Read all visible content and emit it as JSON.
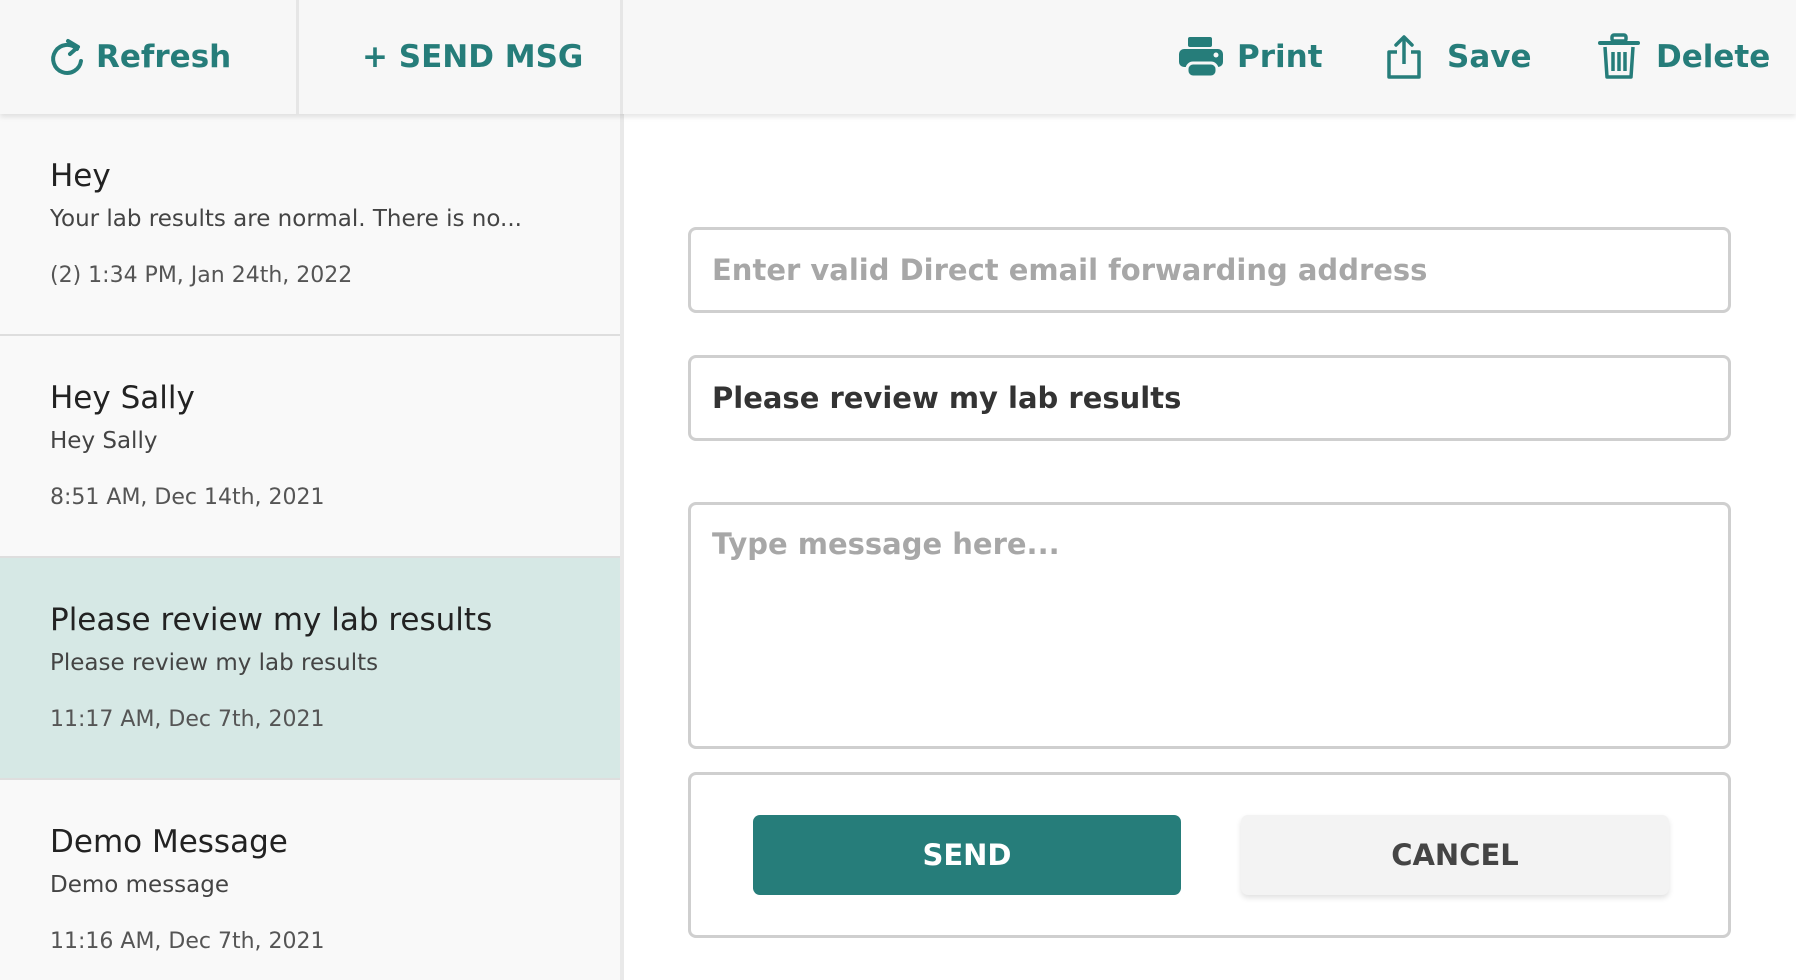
{
  "colors": {
    "accent": "#267d7a",
    "selected_row": "#d6e8e5",
    "toolbar_bg": "#f7f7f7"
  },
  "toolbar": {
    "refresh": {
      "label": "Refresh",
      "icon": "refresh-icon"
    },
    "send_msg": {
      "label": "+ SEND MSG"
    },
    "print": {
      "label": "Print",
      "icon": "printer-icon"
    },
    "save": {
      "label": "Save",
      "icon": "share-upload-icon"
    },
    "delete": {
      "label": "Delete",
      "icon": "trash-icon"
    }
  },
  "messages": [
    {
      "subject": "Hey",
      "preview": "Your lab results are normal. There is no...",
      "date": "(2) 1:34 PM, Jan 24th, 2022",
      "selected": false
    },
    {
      "subject": "Hey Sally",
      "preview": "Hey Sally",
      "date": "8:51 AM, Dec 14th, 2021",
      "selected": false
    },
    {
      "subject": "Please review my lab results",
      "preview": "Please review my lab results",
      "date": "11:17 AM, Dec 7th, 2021",
      "selected": true
    },
    {
      "subject": "Demo Message",
      "preview": "Demo message",
      "date": "11:16 AM, Dec 7th, 2021",
      "selected": false
    }
  ],
  "compose": {
    "forward_address": {
      "value": "",
      "placeholder": "Enter valid Direct email forwarding address"
    },
    "subject": {
      "value": "Please review my lab results",
      "placeholder": ""
    },
    "body": {
      "value": "",
      "placeholder": "Type message here..."
    },
    "send_label": "SEND",
    "cancel_label": "CANCEL"
  }
}
